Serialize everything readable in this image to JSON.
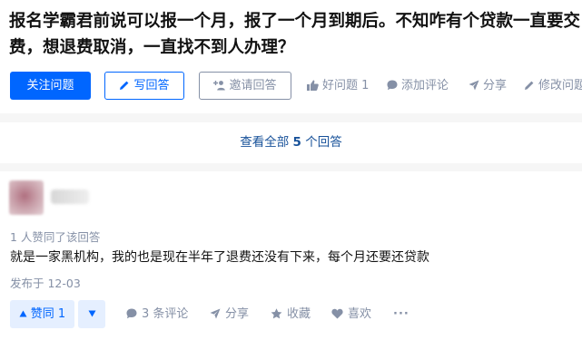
{
  "question": {
    "title": "报名学霸君前说可以报一个月，报了一个月到期后。不知咋有个贷款一直要交费，想退费取消，一直找不到人办理？"
  },
  "actions": {
    "follow": "关注问题",
    "write_answer": "写回答",
    "invite": "邀请回答",
    "good_question": "好问题 1",
    "add_comment": "添加评论",
    "share": "分享",
    "edit": "修改问题"
  },
  "view_all": {
    "prefix": "查看全部 ",
    "count": "5",
    "suffix": " 个回答"
  },
  "answer": {
    "voters": "1 人赞同了该回答",
    "content": "就是一家黑机构，我的也是现在半年了退费还没有下来，每个月还要还贷款",
    "date": "发布于 12-03",
    "vote_up": "赞同 1",
    "comments": "3 条评论",
    "share": "分享",
    "collect": "收藏",
    "like": "喜欢",
    "more": "···"
  },
  "colors": {
    "brand": "#0066ff",
    "muted": "#8590a6",
    "link": "#175199"
  }
}
